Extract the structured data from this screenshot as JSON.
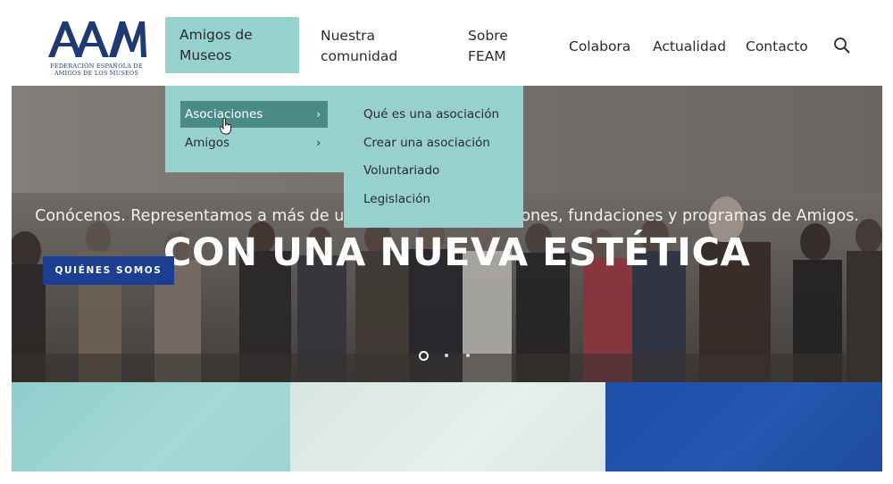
{
  "brand": {
    "logo_mark": "AAM",
    "logo_line1": "FEDERACIÓN ESPAÑOLA DE",
    "logo_line2": "AMIGOS DE LOS MUSEOS",
    "color": "#1f3a73"
  },
  "nav": {
    "items": [
      {
        "label_line1": "Amigos de",
        "label_line2": "Museos",
        "active": true
      },
      {
        "label_line1": "Nuestra",
        "label_line2": "comunidad"
      },
      {
        "label_line1": "Sobre",
        "label_line2": "FEAM"
      },
      {
        "label": "Colabora"
      },
      {
        "label": "Actualidad"
      },
      {
        "label": "Contacto"
      }
    ],
    "search_icon": "search-icon",
    "active_bg": "#97d1cd"
  },
  "submenu": {
    "items": [
      {
        "label": "Asociaciones",
        "chevron": "›",
        "selected": true
      },
      {
        "label": "Amigos",
        "chevron": "›"
      }
    ]
  },
  "flyout": {
    "items": [
      {
        "label": "Qué es una asociación"
      },
      {
        "label": "Crear una asociación"
      },
      {
        "label": "Voluntariado"
      },
      {
        "label": "Legislación"
      }
    ]
  },
  "hero": {
    "subtitle": "Conócenos. Representamos a más de un centenar de asociaciones, fundaciones y programas de Amigos.",
    "title": "CON UNA NUEVA ESTÉTICA",
    "cta_label": "QUIÉNES SOMOS",
    "cta_color": "#1d3f93",
    "slides": 3,
    "active_slide": 1
  },
  "tiles": {
    "colors": [
      "#9fd3d1",
      "#e0ecea",
      "#2255aa"
    ]
  }
}
